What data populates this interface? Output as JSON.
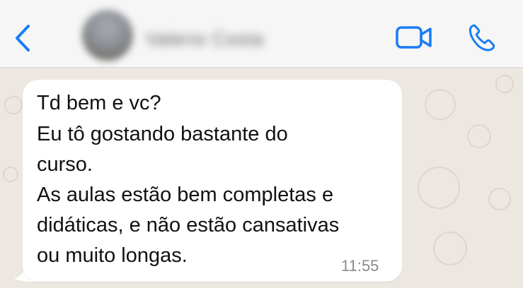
{
  "header": {
    "back_icon": "chevron-left-icon",
    "contact_name": "Valerio Costa",
    "video_icon": "video-camera-icon",
    "call_icon": "phone-icon",
    "accent_color": "#1a7cf5"
  },
  "message": {
    "lines": [
      "Td bem e vc?",
      "Eu tô gostando bastante do",
      "curso.",
      "As aulas estão bem completas e",
      "didáticas, e não estão cansativas",
      "ou muito longas."
    ],
    "time": "11:55"
  }
}
